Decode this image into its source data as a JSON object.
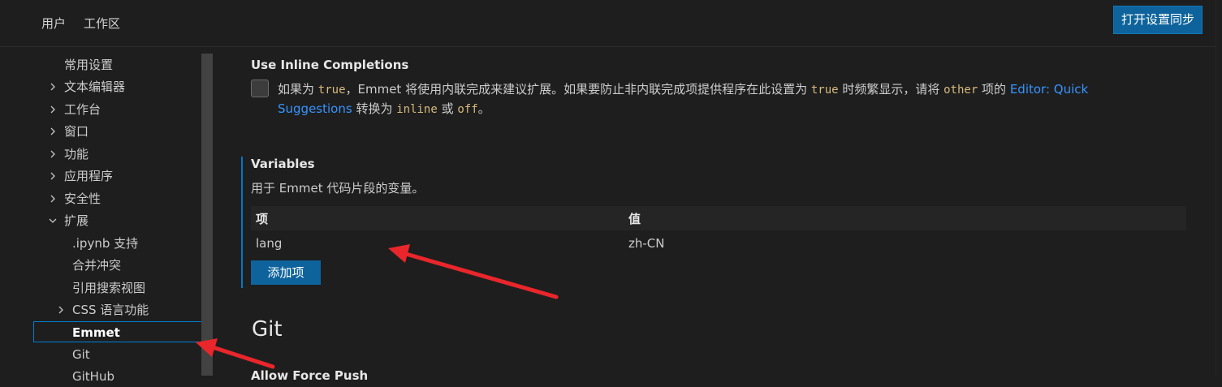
{
  "header": {
    "tabs": [
      {
        "label": "用户"
      },
      {
        "label": "工作区"
      }
    ],
    "sync_button": "打开设置同步"
  },
  "toc": {
    "items": [
      {
        "label": "常用设置"
      },
      {
        "label": "文本编辑器",
        "chevron": "chevron-right-icon"
      },
      {
        "label": "工作台",
        "chevron": "chevron-right-icon"
      },
      {
        "label": "窗口",
        "chevron": "chevron-right-icon"
      },
      {
        "label": "功能",
        "chevron": "chevron-right-icon"
      },
      {
        "label": "应用程序",
        "chevron": "chevron-right-icon"
      },
      {
        "label": "安全性",
        "chevron": "chevron-right-icon"
      },
      {
        "label": "扩展",
        "chevron": "chevron-down-icon"
      },
      {
        "label": ".ipynb 支持"
      },
      {
        "label": "合并冲突"
      },
      {
        "label": "引用搜索视图"
      },
      {
        "label": "CSS 语言功能",
        "chevron": "chevron-right-icon"
      },
      {
        "label": "Emmet"
      },
      {
        "label": "Git"
      },
      {
        "label": "GitHub"
      }
    ]
  },
  "settings": {
    "inline_completions": {
      "title": "Use Inline Completions",
      "checked": false,
      "desc": {
        "t1": "如果为 ",
        "c1": "true",
        "t2": "，Emmet 将使用内联完成来建议扩展。如果要防止非内联完成项提供程序在此设置为 ",
        "c2": "true",
        "t3": " 时频繁显示，请将 ",
        "c3": "other",
        "t4": " 项的 ",
        "link": "Editor: Quick Suggestions",
        "t5": " 转换为 ",
        "c4": "inline",
        "t6": " 或 ",
        "c5": "off",
        "t7": "。"
      }
    },
    "variables": {
      "title": "Variables",
      "desc": "用于 Emmet 代码片段的变量。",
      "columns": {
        "item": "项",
        "value": "值"
      },
      "rows": [
        {
          "item": "lang",
          "value": "zh-CN"
        }
      ],
      "add_button": "添加项"
    },
    "git_section": {
      "heading": "Git",
      "next_title": "Allow Force Push"
    }
  },
  "annotation_color": "#e8262b"
}
